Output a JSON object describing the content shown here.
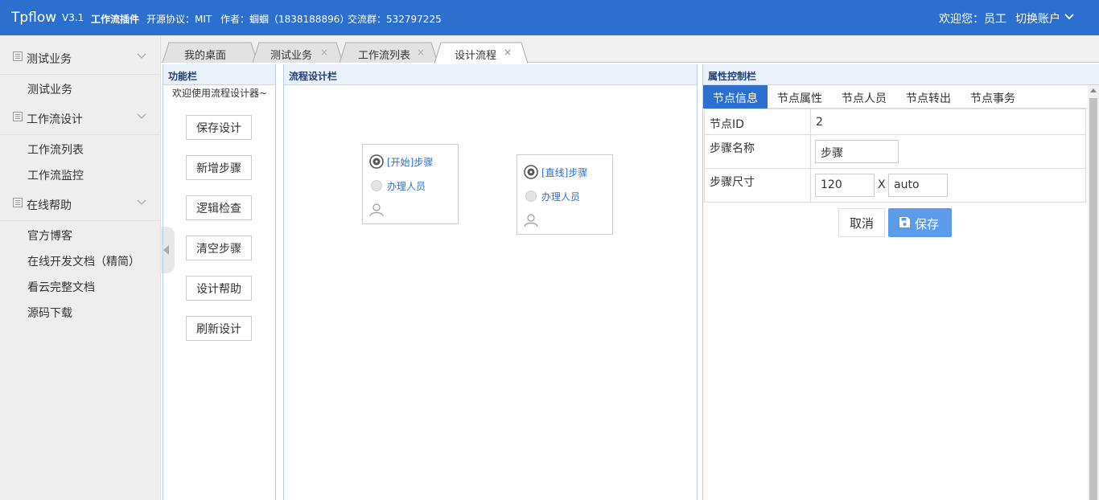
{
  "header": {
    "brand": "Tpflow",
    "version": "V3.1",
    "plugin": "工作流插件",
    "license": "开源协议：MIT",
    "author": "作者：蝈蝈（1838188896）",
    "group": "交流群：532797225",
    "welcome": "欢迎您：员工",
    "switch_account": "切换账户"
  },
  "sidebar": {
    "groups": [
      {
        "label": "测试业务",
        "items": [
          "测试业务"
        ]
      },
      {
        "label": "工作流设计",
        "items": [
          "工作流列表",
          "工作流监控"
        ]
      },
      {
        "label": "在线帮助",
        "items": [
          "官方博客",
          "在线开发文档（精简）",
          "看云完整文档",
          "源码下载"
        ]
      }
    ]
  },
  "tabs": [
    {
      "label": "我的桌面"
    },
    {
      "label": "测试业务",
      "close": "×"
    },
    {
      "label": "工作流列表",
      "close": "×"
    },
    {
      "label": "设计流程",
      "close": "×"
    }
  ],
  "func_panel": {
    "title": "功能栏",
    "welcome": "欢迎使用流程设计器~",
    "buttons": [
      "保存设计",
      "新增步骤",
      "逻辑检查",
      "清空步骤",
      "设计帮助",
      "刷新设计"
    ]
  },
  "design_panel": {
    "title": "流程设计栏",
    "steps": [
      {
        "title": "[开始]步骤",
        "handler": "办理人员"
      },
      {
        "title": "[直线]步骤",
        "handler": "办理人员"
      }
    ]
  },
  "prop_panel": {
    "title": "属性控制栏",
    "tabs": [
      "节点信息",
      "节点属性",
      "节点人员",
      "节点转出",
      "节点事务"
    ],
    "node_id_label": "节点ID",
    "node_id_value": "2",
    "step_name_label": "步骤名称",
    "step_name_value": "步骤",
    "step_size_label": "步骤尺寸",
    "size_width": "120",
    "size_sep": "X",
    "size_height": "auto",
    "cancel": "取消",
    "save": "保存"
  },
  "colors": {
    "primary": "#2d6fcf",
    "save_button": "#5b9bea"
  }
}
